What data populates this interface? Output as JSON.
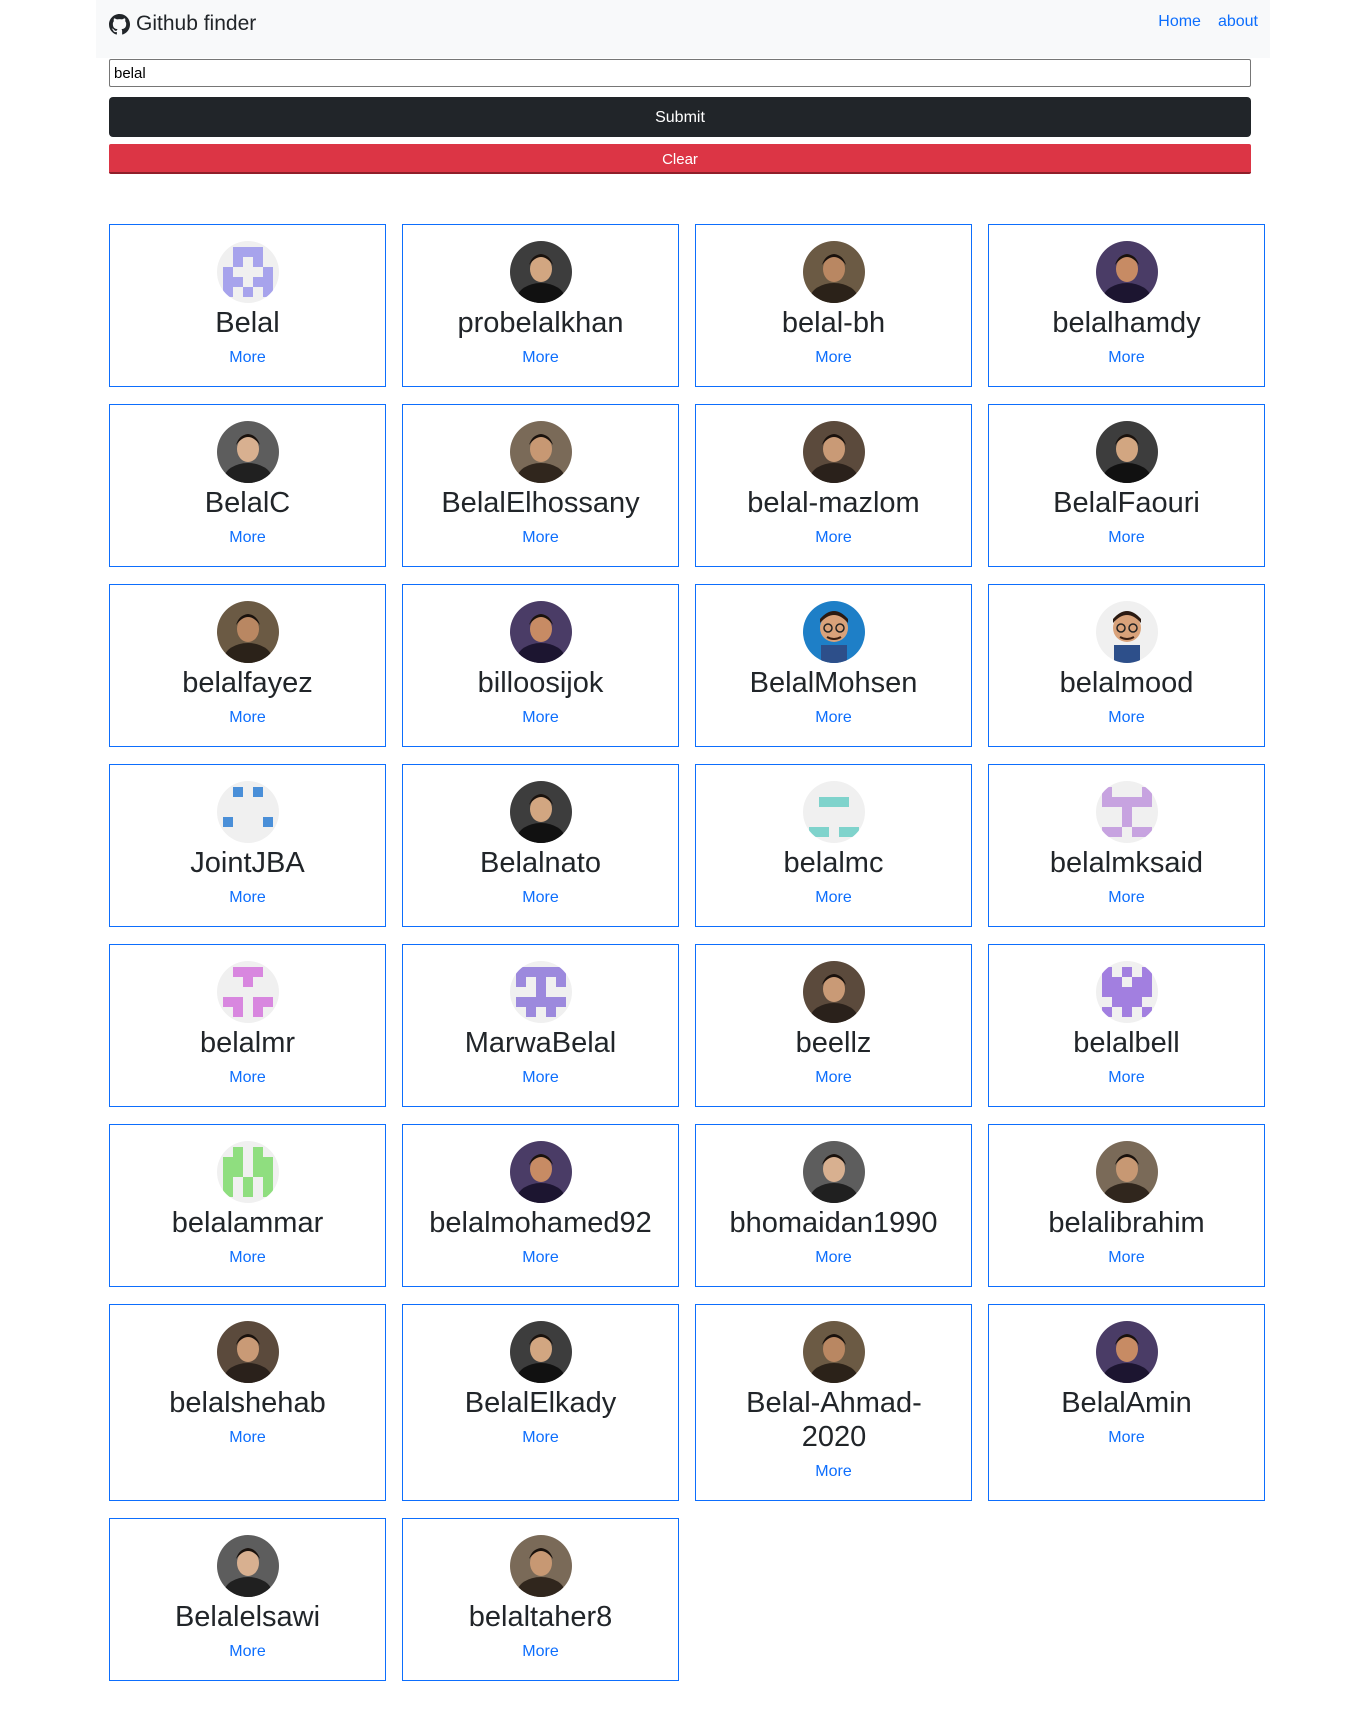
{
  "navbar": {
    "brand": "Github finder",
    "brand_icon": "github-icon",
    "links": [
      "Home",
      "about"
    ]
  },
  "search": {
    "value": "belal"
  },
  "buttons": {
    "submit": "Submit",
    "clear": "Clear"
  },
  "colors": {
    "link": "#0d6efd",
    "submit_bg": "#212529",
    "clear_bg": "#dc3545",
    "navbar_bg": "#f8f9fa"
  },
  "users": [
    {
      "login": "Belal",
      "more": "More",
      "avatar": "identicon-blue"
    },
    {
      "login": "probelalkhan",
      "more": "More",
      "avatar": "photo"
    },
    {
      "login": "belal-bh",
      "more": "More",
      "avatar": "photo"
    },
    {
      "login": "belalhamdy",
      "more": "More",
      "avatar": "photo"
    },
    {
      "login": "BelalC",
      "more": "More",
      "avatar": "photo"
    },
    {
      "login": "BelalElhossany",
      "more": "More",
      "avatar": "photo"
    },
    {
      "login": "belal-mazlom",
      "more": "More",
      "avatar": "photo"
    },
    {
      "login": "BelalFaouri",
      "more": "More",
      "avatar": "photo"
    },
    {
      "login": "belalfayez",
      "more": "More",
      "avatar": "photo"
    },
    {
      "login": "billoosijok",
      "more": "More",
      "avatar": "photo"
    },
    {
      "login": "BelalMohsen",
      "more": "More",
      "avatar": "cartoon"
    },
    {
      "login": "belalmood",
      "more": "More",
      "avatar": "cartoon"
    },
    {
      "login": "JointJBA",
      "more": "More",
      "avatar": "identicon-darkblue"
    },
    {
      "login": "Belalnato",
      "more": "More",
      "avatar": "photo"
    },
    {
      "login": "belalmc",
      "more": "More",
      "avatar": "identicon-teal"
    },
    {
      "login": "belalmksaid",
      "more": "More",
      "avatar": "identicon-lilac"
    },
    {
      "login": "belalmr",
      "more": "More",
      "avatar": "identicon-pink"
    },
    {
      "login": "MarwaBelal",
      "more": "More",
      "avatar": "identicon-violet"
    },
    {
      "login": "beellz",
      "more": "More",
      "avatar": "photo"
    },
    {
      "login": "belalbell",
      "more": "More",
      "avatar": "identicon-purple"
    },
    {
      "login": "belalammar",
      "more": "More",
      "avatar": "identicon-green"
    },
    {
      "login": "belalmohamed92",
      "more": "More",
      "avatar": "photo"
    },
    {
      "login": "bhomaidan1990",
      "more": "More",
      "avatar": "photo"
    },
    {
      "login": "belalibrahim",
      "more": "More",
      "avatar": "photo"
    },
    {
      "login": "belalshehab",
      "more": "More",
      "avatar": "photo"
    },
    {
      "login": "BelalElkady",
      "more": "More",
      "avatar": "photo"
    },
    {
      "login": "Belal-Ahmad-2020",
      "more": "More",
      "avatar": "photo"
    },
    {
      "login": "BelalAmin",
      "more": "More",
      "avatar": "photo"
    },
    {
      "login": "Belalelsawi",
      "more": "More",
      "avatar": "photo"
    },
    {
      "login": "belaltaher8",
      "more": "More",
      "avatar": "photo"
    }
  ]
}
